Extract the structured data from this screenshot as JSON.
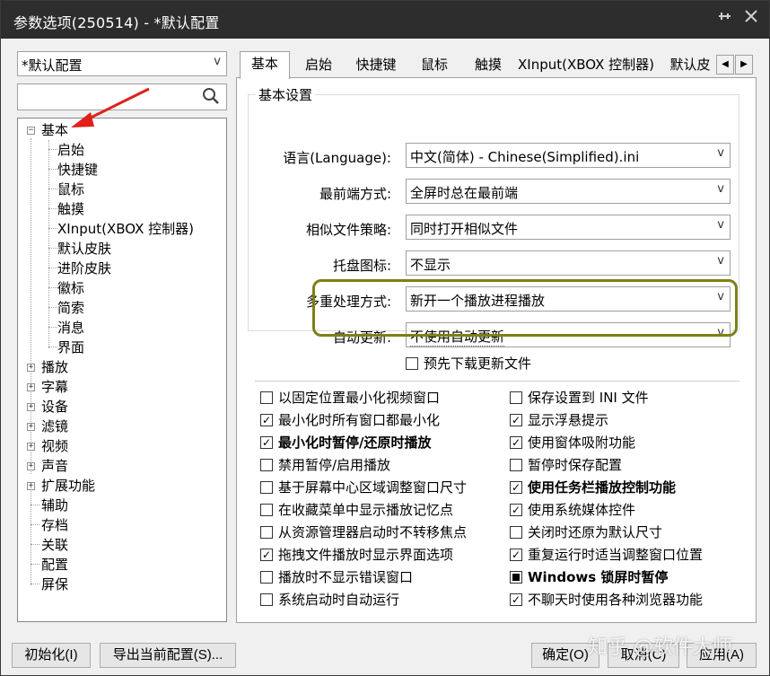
{
  "window": {
    "title": "参数选项(250514) - *默认配置",
    "pin_icon": "pin-icon",
    "close_icon": "close-icon"
  },
  "profile": {
    "value": "*默认配置"
  },
  "search": {
    "placeholder": "",
    "icon": "search-icon"
  },
  "tree": {
    "root": "基本",
    "root_children": [
      "启始",
      "快捷键",
      "鼠标",
      "触摸",
      "XInput(XBOX 控制器)",
      "默认皮肤",
      "进阶皮肤",
      "徽标",
      "简索",
      "消息",
      "界面"
    ],
    "expandable": [
      "播放",
      "字幕",
      "设备",
      "滤镜",
      "视频",
      "声音",
      "扩展功能"
    ],
    "leaves": [
      "辅助",
      "存档",
      "关联",
      "配置",
      "屏保"
    ]
  },
  "tabs": [
    "基本",
    "启始",
    "快捷键",
    "鼠标",
    "触摸",
    "XInput(XBOX 控制器)",
    "默认皮"
  ],
  "basic": {
    "group_title": "基本设置",
    "language_label": "语言(Language):",
    "language_value": "中文(简体) - Chinese(Simplified).ini",
    "ontop_label": "最前端方式:",
    "ontop_value": "全屏时总在最前端",
    "similar_label": "相似文件策略:",
    "similar_value": "同时打开相似文件",
    "tray_label": "托盘图标:",
    "tray_value": "不显示",
    "multi_label": "多重处理方式:",
    "multi_value": "新开一个播放进程播放",
    "update_label": "自动更新:",
    "update_value": "不使用自动更新",
    "predownload_label": "预先下载更新文件",
    "predownload_checked": false
  },
  "checkboxes_left": [
    {
      "label": "以固定位置最小化视频窗口",
      "state": "unchecked",
      "bold": false
    },
    {
      "label": "最小化时所有窗口都最小化",
      "state": "checked",
      "bold": false
    },
    {
      "label": "最小化时暂停/还原时播放",
      "state": "checked",
      "bold": true
    },
    {
      "label": "禁用暂停/启用播放",
      "state": "unchecked",
      "bold": false
    },
    {
      "label": "基于屏幕中心区域调整窗口尺寸",
      "state": "unchecked",
      "bold": false
    },
    {
      "label": "在收藏菜单中显示播放记忆点",
      "state": "unchecked",
      "bold": false
    },
    {
      "label": "从资源管理器启动时不转移焦点",
      "state": "unchecked",
      "bold": false
    },
    {
      "label": "拖拽文件播放时显示界面选项",
      "state": "checked",
      "bold": false
    },
    {
      "label": "播放时不显示错误窗口",
      "state": "unchecked",
      "bold": false
    },
    {
      "label": "系统启动时自动运行",
      "state": "unchecked",
      "bold": false
    }
  ],
  "checkboxes_right": [
    {
      "label": "保存设置到 INI 文件",
      "state": "unchecked",
      "bold": false
    },
    {
      "label": "显示浮悬提示",
      "state": "checked",
      "bold": false
    },
    {
      "label": "使用窗体吸附功能",
      "state": "checked",
      "bold": false
    },
    {
      "label": "暂停时保存配置",
      "state": "unchecked",
      "bold": false
    },
    {
      "label": "使用任务栏播放控制功能",
      "state": "checked",
      "bold": true
    },
    {
      "label": "使用系统媒体控件",
      "state": "checked",
      "bold": false
    },
    {
      "label": "关闭时还原为默认尺寸",
      "state": "unchecked",
      "bold": false
    },
    {
      "label": "重复运行时适当调整窗口位置",
      "state": "checked",
      "bold": false
    },
    {
      "label": "Windows 锁屏时暂停",
      "state": "indeterminate",
      "bold": true
    },
    {
      "label": "不聊天时使用各种浏览器功能",
      "state": "checked",
      "bold": false
    }
  ],
  "buttons": {
    "init": "初始化(I)",
    "export": "导出当前配置(S)...",
    "ok": "确定(O)",
    "cancel": "取消(C)",
    "apply": "应用(A)"
  },
  "watermark": "知乎 @软件大师",
  "colors": {
    "titlebar": "#2d2d2d",
    "highlight": "#7f7f16",
    "arrow": "#e0201a"
  }
}
